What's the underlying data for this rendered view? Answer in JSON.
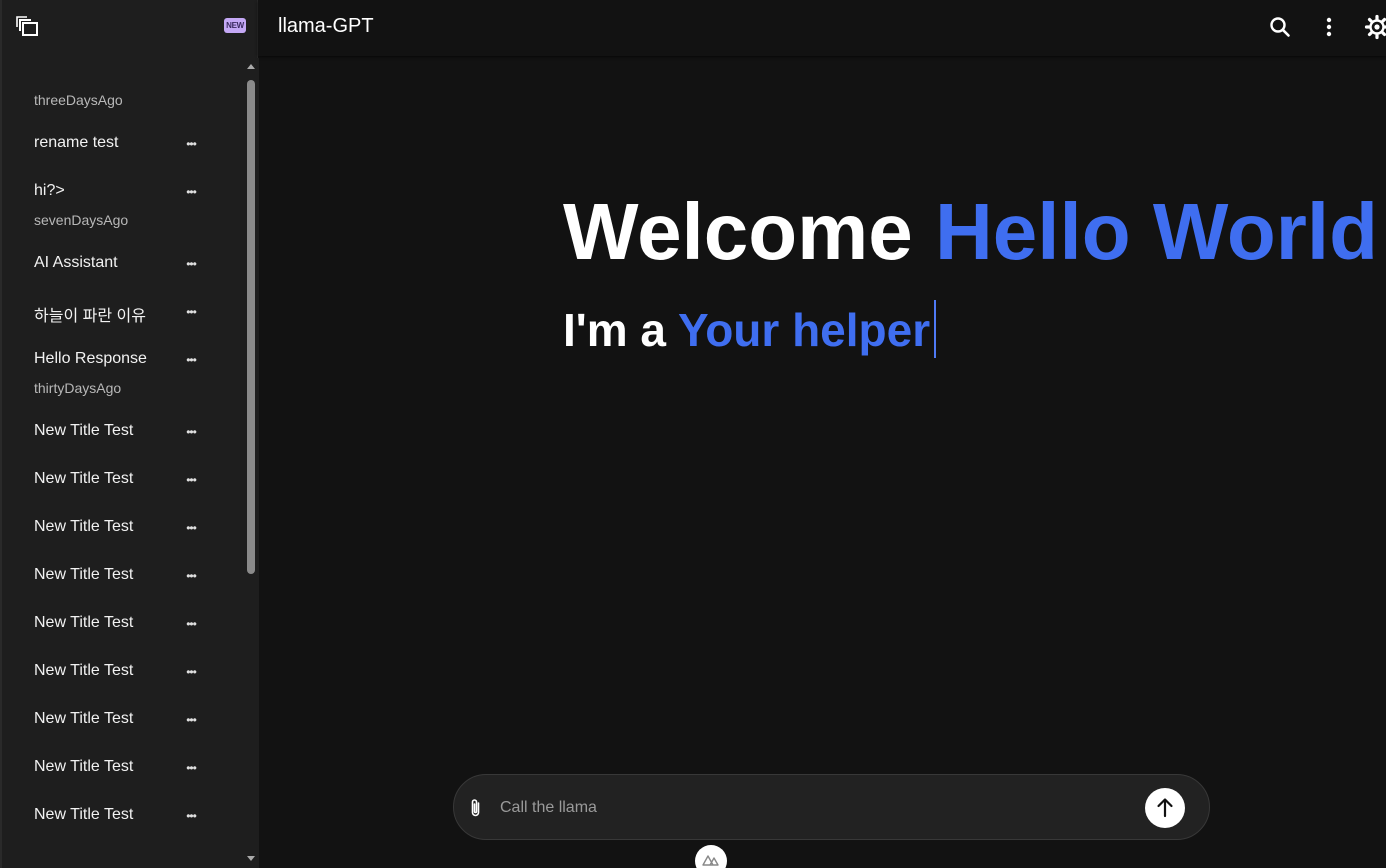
{
  "app": {
    "title": "llama-GPT"
  },
  "sidebar": {
    "new_badge": "NEW",
    "groups": [
      {
        "label": "threeDaysAgo",
        "items": [
          {
            "title": "rename test"
          },
          {
            "title": "hi?>"
          }
        ]
      },
      {
        "label": "sevenDaysAgo",
        "items": [
          {
            "title": "AI Assistant"
          },
          {
            "title": "하늘이 파란 이유"
          },
          {
            "title": "Hello Response"
          }
        ]
      },
      {
        "label": "thirtyDaysAgo",
        "items": [
          {
            "title": "New Title Test"
          },
          {
            "title": "New Title Test"
          },
          {
            "title": "New Title Test"
          },
          {
            "title": "New Title Test"
          },
          {
            "title": "New Title Test"
          },
          {
            "title": "New Title Test"
          },
          {
            "title": "New Title Test"
          },
          {
            "title": "New Title Test"
          },
          {
            "title": "New Title Test"
          }
        ]
      }
    ],
    "item_more": "•••"
  },
  "topbar": {
    "icons": [
      "search-icon",
      "more-vert-icon",
      "settings-icon"
    ]
  },
  "hero": {
    "welcome_prefix": "Welcome",
    "welcome_name": "Hello World",
    "subtitle_prefix": "I'm a",
    "subtitle_typed": "Your helper"
  },
  "composer": {
    "placeholder": "Call the llama",
    "value": ""
  },
  "colors": {
    "accent": "#3f6ef0",
    "background": "#121212",
    "sidebar": "#1e1e1e",
    "badge": "#c4a8f5"
  }
}
